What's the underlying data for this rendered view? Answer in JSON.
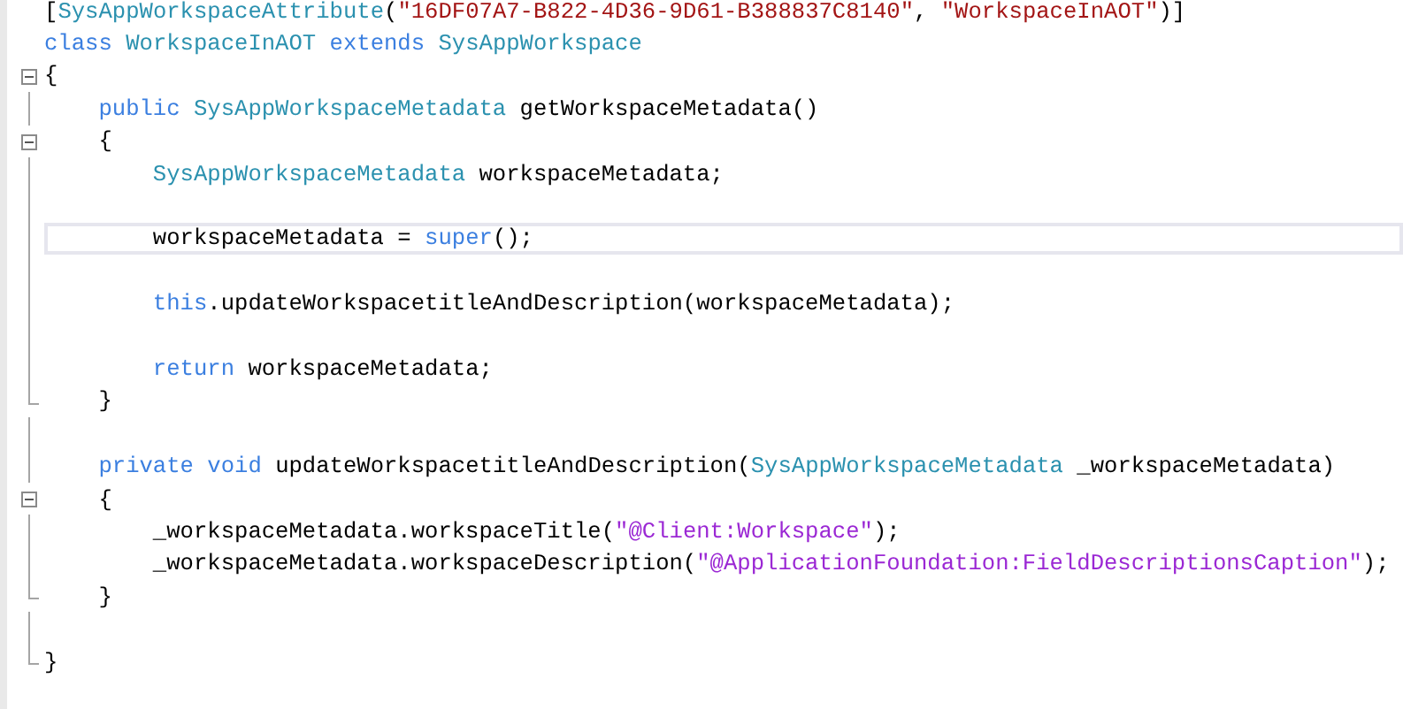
{
  "editor": {
    "lines": [
      {
        "kind": "plain",
        "current": false,
        "tokens": [
          {
            "kind": "plain",
            "text": "["
          },
          {
            "kind": "type",
            "text": "SysAppWorkspaceAttribute"
          },
          {
            "kind": "plain",
            "text": "("
          },
          {
            "kind": "string",
            "text": "\"16DF07A7-B822-4D36-9D61-B388837C8140\""
          },
          {
            "kind": "plain",
            "text": ", "
          },
          {
            "kind": "string",
            "text": "\"WorkspaceInAOT\""
          },
          {
            "kind": "plain",
            "text": ")]"
          }
        ]
      },
      {
        "kind": "plain",
        "current": false,
        "tokens": [
          {
            "kind": "keyword",
            "text": "class"
          },
          {
            "kind": "type",
            "text": " WorkspaceInAOT"
          },
          {
            "kind": "keyword",
            "text": " extends"
          },
          {
            "kind": "type",
            "text": " SysAppWorkspace"
          }
        ]
      },
      {
        "kind": "fold_start",
        "current": false,
        "tokens": [
          {
            "kind": "plain",
            "text": "{"
          }
        ]
      },
      {
        "kind": "guide",
        "current": false,
        "tokens": [
          {
            "kind": "keyword",
            "text": "    public"
          },
          {
            "kind": "type",
            "text": " SysAppWorkspaceMetadata"
          },
          {
            "kind": "plain",
            "text": " getWorkspaceMetadata()"
          }
        ]
      },
      {
        "kind": "fold_start",
        "current": false,
        "tokens": [
          {
            "kind": "plain",
            "text": "    {"
          }
        ]
      },
      {
        "kind": "guide",
        "current": false,
        "tokens": [
          {
            "kind": "type",
            "text": "        SysAppWorkspaceMetadata"
          },
          {
            "kind": "plain",
            "text": " workspaceMetadata;"
          }
        ]
      },
      {
        "kind": "guide",
        "current": false
      },
      {
        "kind": "guide",
        "current": true,
        "tokens": [
          {
            "kind": "plain",
            "text": "        workspaceMetadata = "
          },
          {
            "kind": "keyword",
            "text": "super"
          },
          {
            "kind": "plain",
            "text": "();"
          }
        ]
      },
      {
        "kind": "guide",
        "current": false
      },
      {
        "kind": "guide",
        "current": false,
        "tokens": [
          {
            "kind": "keyword",
            "text": "        this"
          },
          {
            "kind": "plain",
            "text": ".updateWorkspacetitleAndDescription(workspaceMetadata);"
          }
        ]
      },
      {
        "kind": "guide",
        "current": false
      },
      {
        "kind": "guide",
        "current": false,
        "tokens": [
          {
            "kind": "keyword",
            "text": "        return"
          },
          {
            "kind": "plain",
            "text": " workspaceMetadata;"
          }
        ]
      },
      {
        "kind": "fold_end",
        "current": false,
        "tokens": [
          {
            "kind": "plain",
            "text": "    }"
          }
        ]
      },
      {
        "kind": "guide",
        "current": false
      },
      {
        "kind": "guide",
        "current": false,
        "tokens": [
          {
            "kind": "keyword",
            "text": "    private"
          },
          {
            "kind": "keyword",
            "text": " void"
          },
          {
            "kind": "plain",
            "text": " updateWorkspacetitleAndDescription("
          },
          {
            "kind": "type",
            "text": "SysAppWorkspaceMetadata"
          },
          {
            "kind": "plain",
            "text": " _workspaceMetadata)"
          }
        ]
      },
      {
        "kind": "fold_start",
        "current": false,
        "tokens": [
          {
            "kind": "plain",
            "text": "    {"
          }
        ]
      },
      {
        "kind": "guide",
        "current": false,
        "tokens": [
          {
            "kind": "plain",
            "text": "        _workspaceMetadata.workspaceTitle("
          },
          {
            "kind": "label",
            "text": "\"@Client:Workspace\""
          },
          {
            "kind": "plain",
            "text": ");"
          }
        ]
      },
      {
        "kind": "guide",
        "current": false,
        "tokens": [
          {
            "kind": "plain",
            "text": "        _workspaceMetadata.workspaceDescription("
          },
          {
            "kind": "label",
            "text": "\"@ApplicationFoundation:FieldDescriptionsCaption\""
          },
          {
            "kind": "plain",
            "text": ");"
          }
        ]
      },
      {
        "kind": "fold_end",
        "current": false,
        "tokens": [
          {
            "kind": "plain",
            "text": "    }"
          }
        ]
      },
      {
        "kind": "guide",
        "current": false
      },
      {
        "kind": "fold_end",
        "current": false,
        "tokens": [
          {
            "kind": "plain",
            "text": "}"
          }
        ]
      }
    ]
  }
}
